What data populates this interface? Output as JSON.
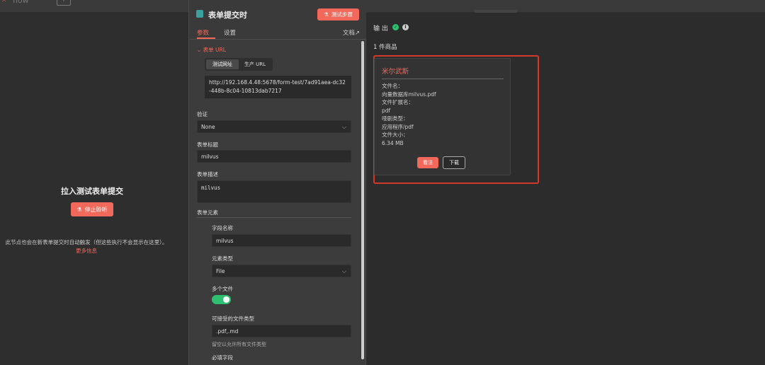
{
  "topbar": {
    "title": "flow",
    "add_label": "+"
  },
  "left": {
    "heading": "拉入测试表单提交",
    "stop_button": "停止聆听",
    "note": "此节点也会在新表单提交时自动触发（但这些执行不会显示在这里）。",
    "more_link": "更多信息"
  },
  "node": {
    "title": "表单提交时",
    "test_button": "测试步骤",
    "tabs": [
      "参数",
      "设置"
    ],
    "docs_link": "文档",
    "url_section": "表单 URL",
    "url_tabs": [
      "测试网址",
      "生产 URL"
    ],
    "url_value": "http://192.168.4.48:5678/form-test/7ad91aea-dc32-448b-8c04-10813dab7217",
    "auth_label": "验证",
    "auth_value": "None",
    "form_title_label": "表单标题",
    "form_title_value": "milvus",
    "form_desc_label": "表单描述",
    "form_desc_value": "milvus",
    "elements_label": "表单元素",
    "field_name_label": "字段名称",
    "field_name_value": "milvus",
    "element_type_label": "元素类型",
    "element_type_value": "File",
    "multiple_files_label": "多个文件",
    "multiple_files_on": true,
    "accepted_types_label": "可接受的文件类型",
    "accepted_types_value": ".pdf,.md",
    "accepted_types_hint": "留空以允许所有文件类型",
    "required_label": "必填字段"
  },
  "output": {
    "label": "输 出",
    "count": "1 件商品",
    "item": {
      "name": "米尔武斯",
      "lines": [
        "文件名：",
        "向量数据库milvus.pdf",
        "文件扩展名：",
        "pdf",
        "哑剧类型：",
        "应用程序/pdf",
        "文件大小：",
        "6.34 MB"
      ],
      "view_button": "看法",
      "download_button": "下载"
    }
  },
  "colors": {
    "accent": "#f2685b",
    "success": "#2fbf71",
    "selection": "#d33a2c"
  }
}
